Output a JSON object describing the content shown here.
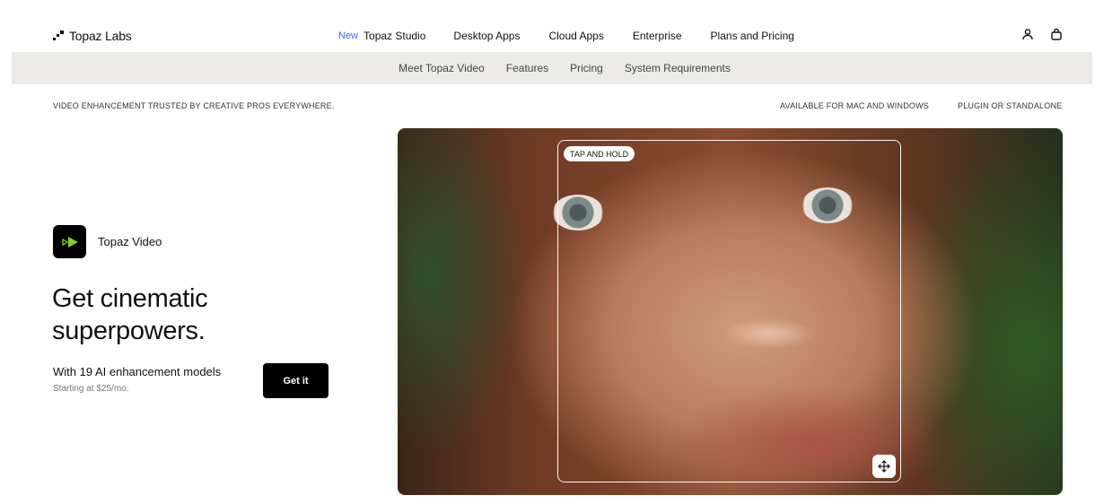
{
  "brand": {
    "name": "Topaz Labs"
  },
  "nav": {
    "new_badge": "New",
    "items": [
      "Topaz Studio",
      "Desktop Apps",
      "Cloud Apps",
      "Enterprise",
      "Plans and Pricing"
    ]
  },
  "header_icons": [
    "user-icon",
    "bag-icon"
  ],
  "subnav": {
    "items": [
      "Meet Topaz Video",
      "Features",
      "Pricing",
      "System Requirements"
    ]
  },
  "taglines": {
    "left": "VIDEO ENHANCEMENT TRUSTED BY CREATIVE PROS EVERYWHERE.",
    "right1": "AVAILABLE FOR MAC AND WINDOWS",
    "right2": "PLUGIN OR STANDALONE"
  },
  "hero": {
    "product_name": "Topaz Video",
    "headline": "Get cinematic superpowers.",
    "subtitle": "With 19 AI enhancement models",
    "price_note": "Starting at $25/mo.",
    "cta_label": "Get it"
  },
  "media": {
    "overlay_label": "TAP AND HOLD",
    "drag_icon": "move-icon"
  },
  "colors": {
    "accent": "#3b6fe0",
    "app_icon_green": "#7ed321",
    "subnav_bg": "#ecebe8"
  }
}
